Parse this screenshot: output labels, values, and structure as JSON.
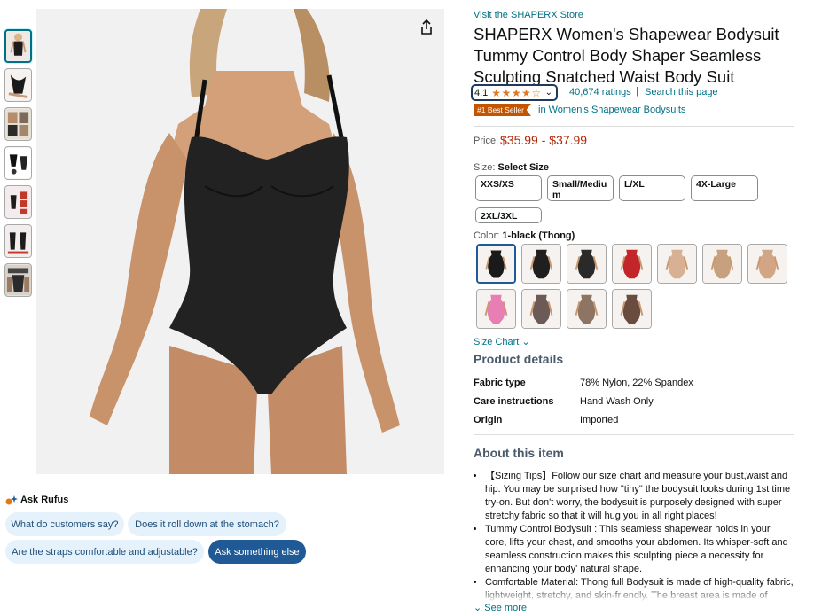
{
  "store_link": "Visit the SHAPERX Store",
  "title": "SHAPERX Women's Shapewear Bodysuit Tummy Control Body Shaper Seamless Sculpting Snatched Waist Body Suit",
  "rating": {
    "value": "4.1",
    "stars": "★★★★☆",
    "count": "40,674 ratings",
    "separator": "|",
    "search": "Search this page"
  },
  "badge": {
    "label": "#1 Best Seller",
    "category": "in Women's Shapewear Bodysuits"
  },
  "price": {
    "label": "Price:",
    "value": "$35.99 - $37.99"
  },
  "size": {
    "label": "Size:",
    "selected": "Select Size",
    "options": [
      "XXS/XS",
      "Small/Mediu m",
      "L/XL",
      "4X-Large",
      "2XL/3XL"
    ]
  },
  "color": {
    "label": "Color:",
    "selected": "1-black (Thong)",
    "swatches": [
      "#1a1a1a",
      "#1f1f1f",
      "#2a2a2a",
      "#c2262a",
      "#d8b194",
      "#c7a07f",
      "#d2a585",
      "#e77fb4",
      "#6b5a56",
      "#8e7463",
      "#6a4c3e"
    ]
  },
  "size_chart": "Size Chart",
  "product_details": {
    "heading": "Product details",
    "rows": [
      {
        "key": "Fabric type",
        "value": "78% Nylon, 22% Spandex"
      },
      {
        "key": "Care instructions",
        "value": "Hand Wash Only"
      },
      {
        "key": "Origin",
        "value": "Imported"
      }
    ]
  },
  "about": {
    "heading": "About this item",
    "bullets": [
      "【Sizing Tips】Follow our size chart and measure your bust,waist and hip. You may be surprised how \"tiny\" the bodysuit looks during 1st time try-on. But don't worry, the bodysuit is purposely designed with super stretchy fabric so that it will hug you in all right places!",
      "Tummy Control Bodysuit : This seamless shapewear holds in your core, lifts your chest, and smooths your abdomen. Its whisper-soft and seamless construction makes this sculpting piece a necessity for enhancing your body' natural shape.",
      "Comfortable Material: Thong full Bodysuit is made of high-quality fabric, lightweight, stretchy, and skin-friendly. The breast area is made of"
    ],
    "see_more": "See more"
  },
  "rufus": {
    "label": "Ask Rufus",
    "chips": [
      "What do customers say?",
      "Does it roll down at the stomach?",
      "Are the straps comfortable and adjustable?",
      "Ask something else"
    ]
  },
  "colors": {
    "link": "#007185",
    "price": "#B12704",
    "badge": "#c45500",
    "star": "#de7921",
    "chip_bg": "#e5f2fb",
    "chip_dark": "#1f5a96"
  }
}
